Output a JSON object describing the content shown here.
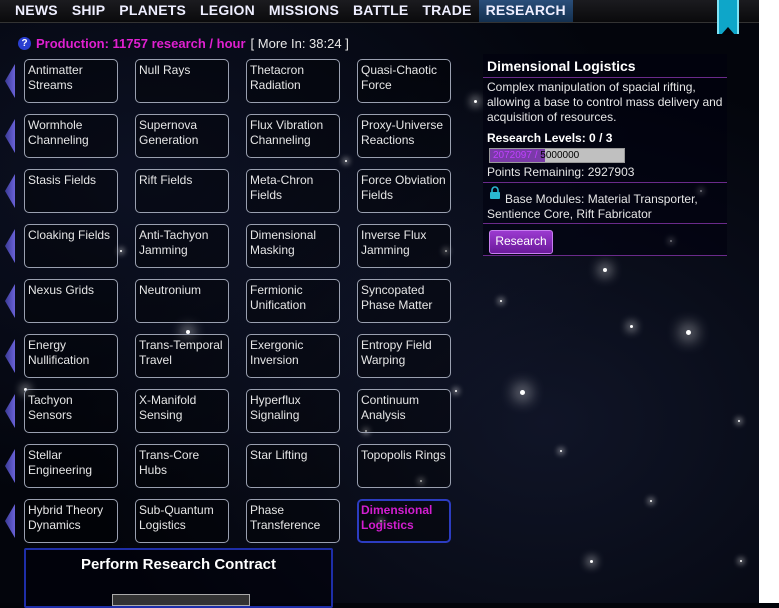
{
  "nav": {
    "items": [
      {
        "label": "NEWS",
        "active": false
      },
      {
        "label": "SHIP",
        "active": false
      },
      {
        "label": "PLANETS",
        "active": false
      },
      {
        "label": "LEGION",
        "active": false
      },
      {
        "label": "MISSIONS",
        "active": false
      },
      {
        "label": "BATTLE",
        "active": false
      },
      {
        "label": "TRADE",
        "active": false
      },
      {
        "label": "RESEARCH",
        "active": true
      }
    ]
  },
  "production": {
    "help_icon": "help-icon",
    "text": "Production: 11757 research / hour",
    "more": "[ More In: 38:24 ]"
  },
  "research_grid": [
    [
      "Antimatter Streams",
      "Null Rays",
      "Thetacron Radiation",
      "Quasi-Chaotic Force"
    ],
    [
      "Wormhole Channeling",
      "Supernova Generation",
      "Flux Vibration Channeling",
      "Proxy-Universe Reactions"
    ],
    [
      "Stasis Fields",
      "Rift Fields",
      "Meta-Chron Fields",
      "Force Obviation Fields"
    ],
    [
      "Cloaking Fields",
      "Anti-Tachyon Jamming",
      "Dimensional Masking",
      "Inverse Flux Jamming"
    ],
    [
      "Nexus Grids",
      "Neutronium",
      "Fermionic Unification",
      "Syncopated Phase Matter"
    ],
    [
      "Energy Nullification",
      "Trans-Temporal Travel",
      "Exergonic Inversion",
      "Entropy Field Warping"
    ],
    [
      "Tachyon Sensors",
      "X-Manifold Sensing",
      "Hyperflux Signaling",
      "Continuum Analysis"
    ],
    [
      "Stellar Engineering",
      "Trans-Core Hubs",
      "Star Lifting",
      "Topopolis Rings"
    ],
    [
      "Hybrid Theory Dynamics",
      "Sub-Quantum Logistics",
      "Phase Transference",
      "Dimensional Logistics"
    ]
  ],
  "selected": "Dimensional Logistics",
  "contract": {
    "title": "Perform Research Contract"
  },
  "detail": {
    "title": "Dimensional Logistics",
    "description": "Complex manipulation of spacial rifting, allowing a base to control mass delivery and acquisition of resources.",
    "levels": "Research Levels: 0 / 3",
    "progress_current": "2072097",
    "progress_sep": " / ",
    "progress_total": "5000000",
    "progress_fraction": 0.414,
    "points": "Points Remaining: 2927903",
    "lock_icon": "lock-icon",
    "modules": "Base Modules: Material Transporter, Sentience Core, Rift Fabricator",
    "button": "Research"
  },
  "colors": {
    "accent": "#d21ed0",
    "selected_border": "#2c3cc0",
    "nav_active": "#2a4e7a",
    "button": "#8a2ac0"
  }
}
